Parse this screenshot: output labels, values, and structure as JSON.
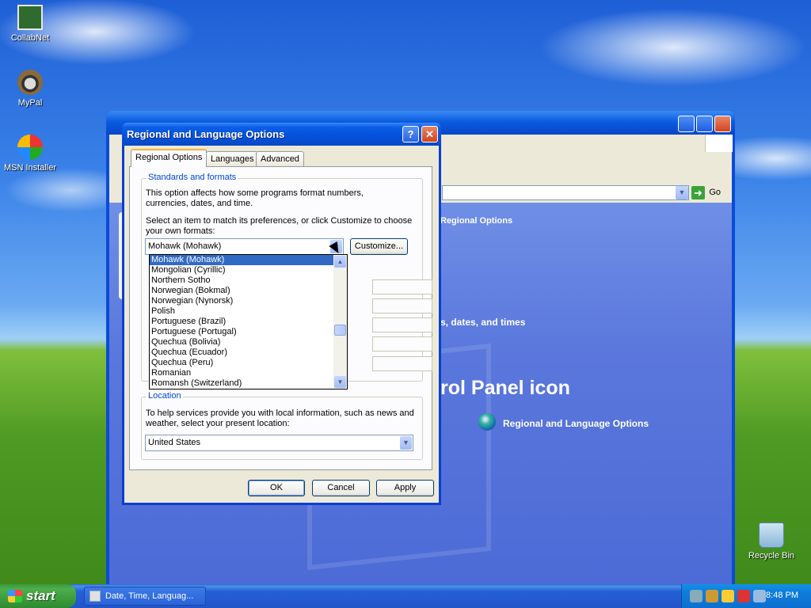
{
  "desktop": {
    "icons": [
      {
        "label": "CollabNet"
      },
      {
        "label": "MyPal"
      },
      {
        "label": "MSN Installer"
      },
      {
        "label": "Recycle Bin"
      }
    ]
  },
  "background_window": {
    "address_go": "Go",
    "task_heading": "Regional Options",
    "dates_text": "s, dates, and times",
    "control_panel_heading": "rol Panel icon",
    "control_panel_item": "Regional and Language Options"
  },
  "dialog": {
    "title": "Regional and Language Options",
    "help_button": "?",
    "close_button": "✕",
    "tabs": [
      {
        "label": "Regional Options",
        "active": true
      },
      {
        "label": "Languages",
        "active": false
      },
      {
        "label": "Advanced",
        "active": false
      }
    ],
    "standards": {
      "group_label": "Standards and formats",
      "description": "This option affects how some programs format numbers, currencies, dates, and time.",
      "instruction": "Select an item to match its preferences, or click Customize to choose your own formats:",
      "selected_format": "Mohawk (Mohawk)",
      "customize_button": "Customize...",
      "dropdown_options": [
        "Mohawk (Mohawk)",
        "Mongolian (Cyrillic)",
        "Northern Sotho",
        "Norwegian (Bokmal)",
        "Norwegian (Nynorsk)",
        "Polish",
        "Portuguese (Brazil)",
        "Portuguese (Portugal)",
        "Quechua (Bolivia)",
        "Quechua (Ecuador)",
        "Quechua (Peru)",
        "Romanian",
        "Romansh (Switzerland)"
      ],
      "highlighted_index": 0
    },
    "location": {
      "group_label": "Location",
      "description": "To help services provide you with local information, such as news and weather, select your present location:",
      "selected": "United States"
    },
    "buttons": {
      "ok": "OK",
      "cancel": "Cancel",
      "apply": "Apply"
    }
  },
  "taskbar": {
    "start_label": "start",
    "task_label": "Date, Time, Languag...",
    "clock": "8:48 PM"
  },
  "colors": {
    "title_bar": "#0550dc",
    "selection": "#316ac5",
    "group_label": "#0046d5",
    "dialog_face": "#ece9d8"
  }
}
